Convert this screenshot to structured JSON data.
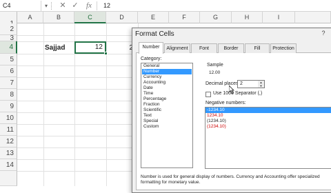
{
  "formula_bar": {
    "name_box": "C4",
    "cancel_glyph": "✕",
    "enter_glyph": "✓",
    "fx_glyph": "fx",
    "value": "12"
  },
  "sheet": {
    "columns": [
      "A",
      "B",
      "C",
      "D",
      "E",
      "F",
      "G",
      "H",
      "I"
    ],
    "rows": [
      "1",
      "2",
      "3",
      "4",
      "5",
      "6",
      "7",
      "8",
      "9",
      "10",
      "11",
      "12",
      "13",
      "14"
    ],
    "cells": {
      "B4": "Sajjad",
      "C4": "12",
      "D4": "2"
    }
  },
  "dialog": {
    "title": "Format Cells",
    "help_glyph": "?",
    "tabs": [
      "Number",
      "Alignment",
      "Font",
      "Border",
      "Fill",
      "Protection"
    ],
    "category_label": "Category:",
    "categories": [
      "General",
      "Number",
      "Currency",
      "Accounting",
      "Date",
      "Time",
      "Percentage",
      "Fraction",
      "Scientific",
      "Text",
      "Special",
      "Custom"
    ],
    "selected_category": "Number",
    "sample_label": "Sample",
    "sample_value": "12.00",
    "decimal_places_label": "Decimal places:",
    "decimal_places_value": "2",
    "use_separator_label": "Use 1000 Separator (,)",
    "negative_numbers_label": "Negative numbers:",
    "negative_numbers": [
      "-1234.10",
      "1234.10",
      "(1234.10)",
      "(1234.10)"
    ],
    "description": "Number is used for general display of numbers.  Currency and Accounting offer specialized formatting for monetary value."
  },
  "colors": {
    "excel_green": "#217346",
    "selection_blue": "#3399ff",
    "negative_red": "#cc0000"
  }
}
